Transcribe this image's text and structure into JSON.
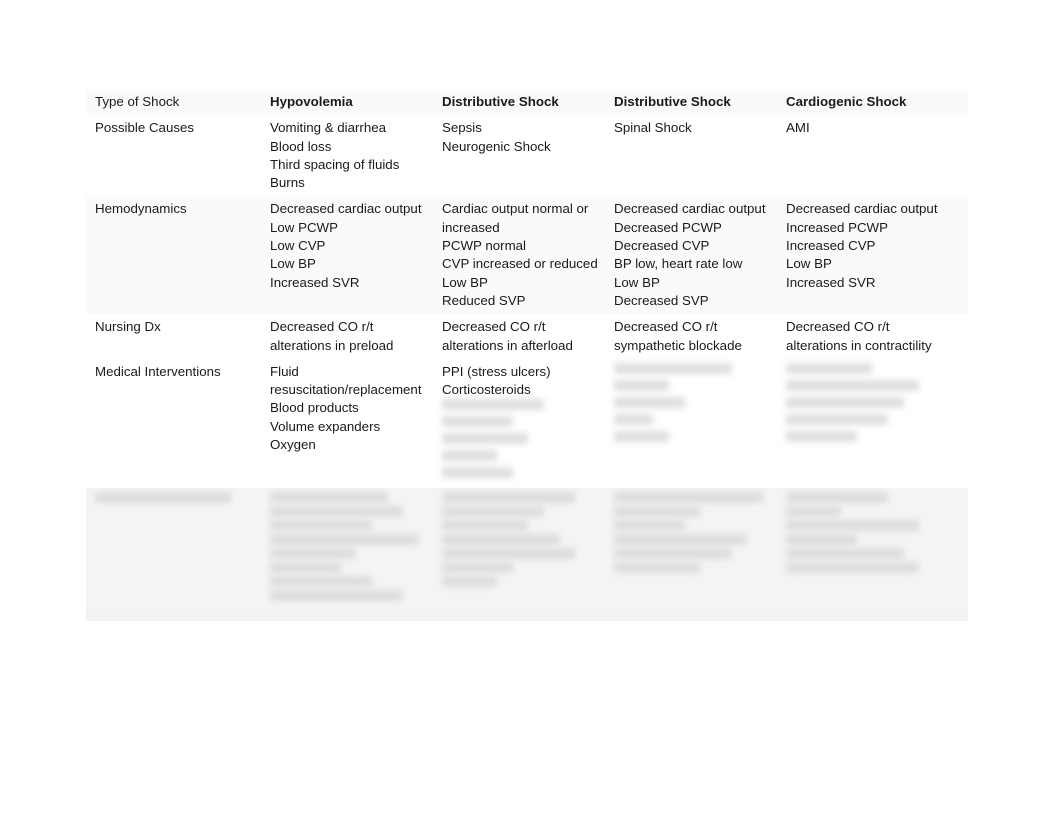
{
  "document": {
    "title": "Types of Shock Comparison Table"
  },
  "table": {
    "columns": [
      {
        "key": "label",
        "header": "Type of Shock"
      },
      {
        "key": "hypo",
        "header": "Hypovolemia"
      },
      {
        "key": "distrib",
        "header": "Distributive Shock"
      },
      {
        "key": "spinal",
        "header": "Distributive Shock"
      },
      {
        "key": "cardio",
        "header": "Cardiogenic Shock"
      }
    ],
    "rows": [
      {
        "label": "Possible Causes",
        "hypo": "Vomiting & diarrhea\nBlood loss\nThird spacing of fluids\nBurns",
        "distrib": "Sepsis\nNeurogenic Shock",
        "spinal": "Spinal Shock",
        "cardio": "AMI"
      },
      {
        "label": "Hemodynamics",
        "hypo": "Decreased cardiac output\nLow PCWP\nLow CVP\nLow BP\nIncreased SVR",
        "distrib": "Cardiac output normal or increased\nPCWP normal\nCVP increased or reduced\nLow BP\nReduced SVP",
        "spinal": "Decreased cardiac output\nDecreased PCWP\nDecreased CVP\nBP low, heart rate low\nLow BP\nDecreased SVP",
        "cardio": "Decreased cardiac output\nIncreased PCWP\nIncreased CVP\nLow BP\nIncreased SVR"
      },
      {
        "label": "Nursing Dx",
        "hypo": "Decreased CO r/t alterations in preload",
        "distrib": "Decreased CO r/t alterations in afterload",
        "spinal": "Decreased CO r/t sympathetic blockade",
        "cardio": "Decreased CO r/t alterations in contractility"
      },
      {
        "label": "Medical Interventions",
        "hypo": "Fluid resuscitation/replacement\nBlood products\nVolume expanders\nOxygen",
        "distrib": "PPI (stress ulcers)\nCorticosteroids",
        "distrib_redacted": true,
        "spinal": "",
        "spinal_redacted": true,
        "cardio": "",
        "cardio_redacted": true
      },
      {
        "label": "",
        "label_redacted": true,
        "hypo": "",
        "hypo_redacted": true,
        "distrib": "",
        "distrib_redacted": true,
        "spinal": "",
        "spinal_redacted": true,
        "cardio": "",
        "cardio_redacted": true
      }
    ]
  },
  "notes": {
    "redacted_label": "illegible blurred content"
  },
  "colors": {
    "page_background": "#ffffff",
    "cell_background": "#ffffff",
    "band_background": "#f4f4f4",
    "text": "#1a1a1a",
    "redaction": "#d9d9d9"
  }
}
